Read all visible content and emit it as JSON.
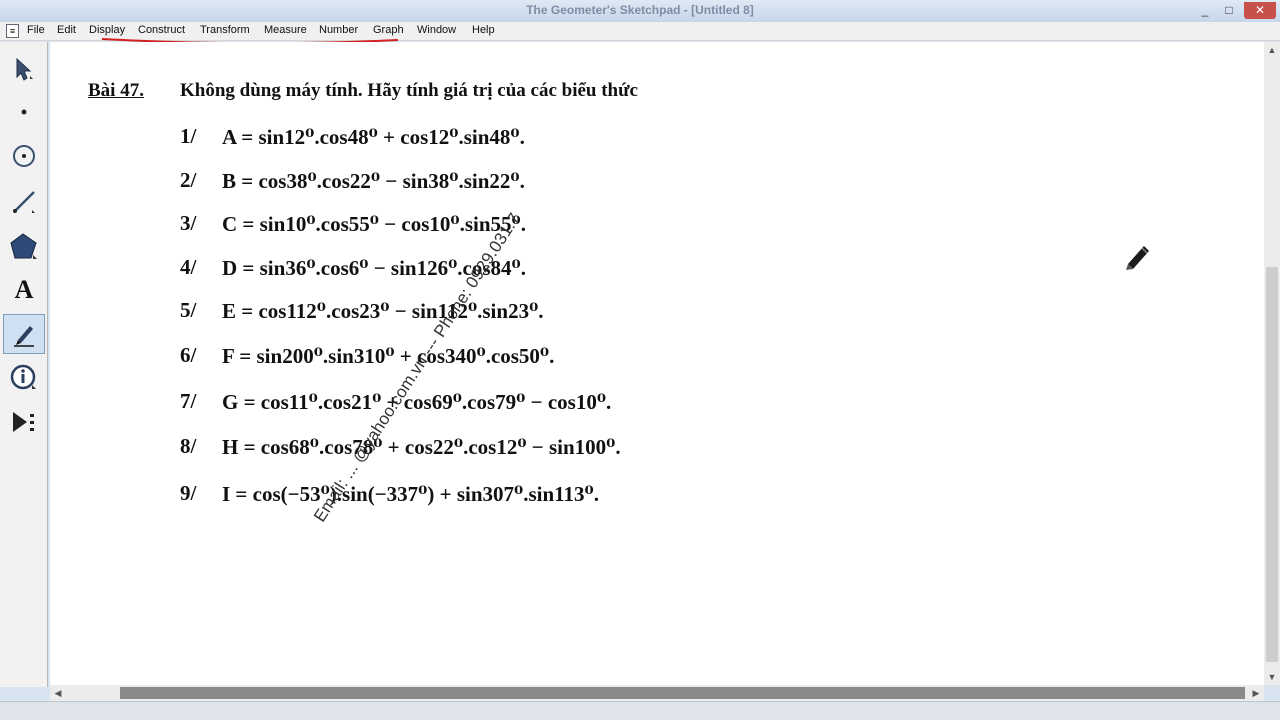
{
  "window": {
    "title": "The Geometer's Sketchpad - [Untitled 8]",
    "minimize": "_",
    "maximize": "□",
    "close": "✕"
  },
  "menu": [
    "File",
    "Edit",
    "Display",
    "Construct",
    "Transform",
    "Measure",
    "Number",
    "Graph",
    "Window",
    "Help"
  ],
  "tools": [
    {
      "name": "arrow-tool-icon"
    },
    {
      "name": "point-tool-icon"
    },
    {
      "name": "compass-tool-icon"
    },
    {
      "name": "straightedge-tool-icon"
    },
    {
      "name": "polygon-tool-icon"
    },
    {
      "name": "text-tool-icon",
      "glyph": "A"
    },
    {
      "name": "marker-tool-icon",
      "active": true
    },
    {
      "name": "information-tool-icon"
    },
    {
      "name": "custom-tool-icon"
    }
  ],
  "document": {
    "heading": "Bài 47.",
    "intro": "Không dùng máy tính. Hãy tính giá trị của các biểu thức",
    "problems": [
      {
        "num": "1/",
        "expr": "A = sin12⁰.cos48⁰ + cos12⁰.sin48⁰."
      },
      {
        "num": "2/",
        "expr": "B = cos38⁰.cos22⁰ − sin38⁰.sin22⁰."
      },
      {
        "num": "3/",
        "expr": "C = sin10⁰.cos55⁰ − cos10⁰.sin55⁰."
      },
      {
        "num": "4/",
        "expr": "D = sin36⁰.cos6⁰ − sin126⁰.cos84⁰."
      },
      {
        "num": "5/",
        "expr": "E = cos112⁰.cos23⁰ − sin112⁰.sin23⁰."
      },
      {
        "num": "6/",
        "expr": "F = sin200⁰.sin310⁰ + cos340⁰.cos50⁰."
      },
      {
        "num": "7/",
        "expr": "G = cos11⁰.cos21⁰ + cos69⁰.cos79⁰ − cos10⁰."
      },
      {
        "num": "8/",
        "expr": "H = cos68⁰.cos78⁰ + cos22⁰.cos12⁰ − sin100⁰."
      },
      {
        "num": "9/",
        "expr": "I = cos(−53⁰).sin(−337⁰) + sin307⁰.sin113⁰."
      }
    ],
    "watermark": "Email: ... @yahoo.com.vn --- Phone: 0929.031.7"
  },
  "colors": {
    "menu_underline": "#d42020",
    "selected_tool_bg": "#cfe0f2"
  }
}
